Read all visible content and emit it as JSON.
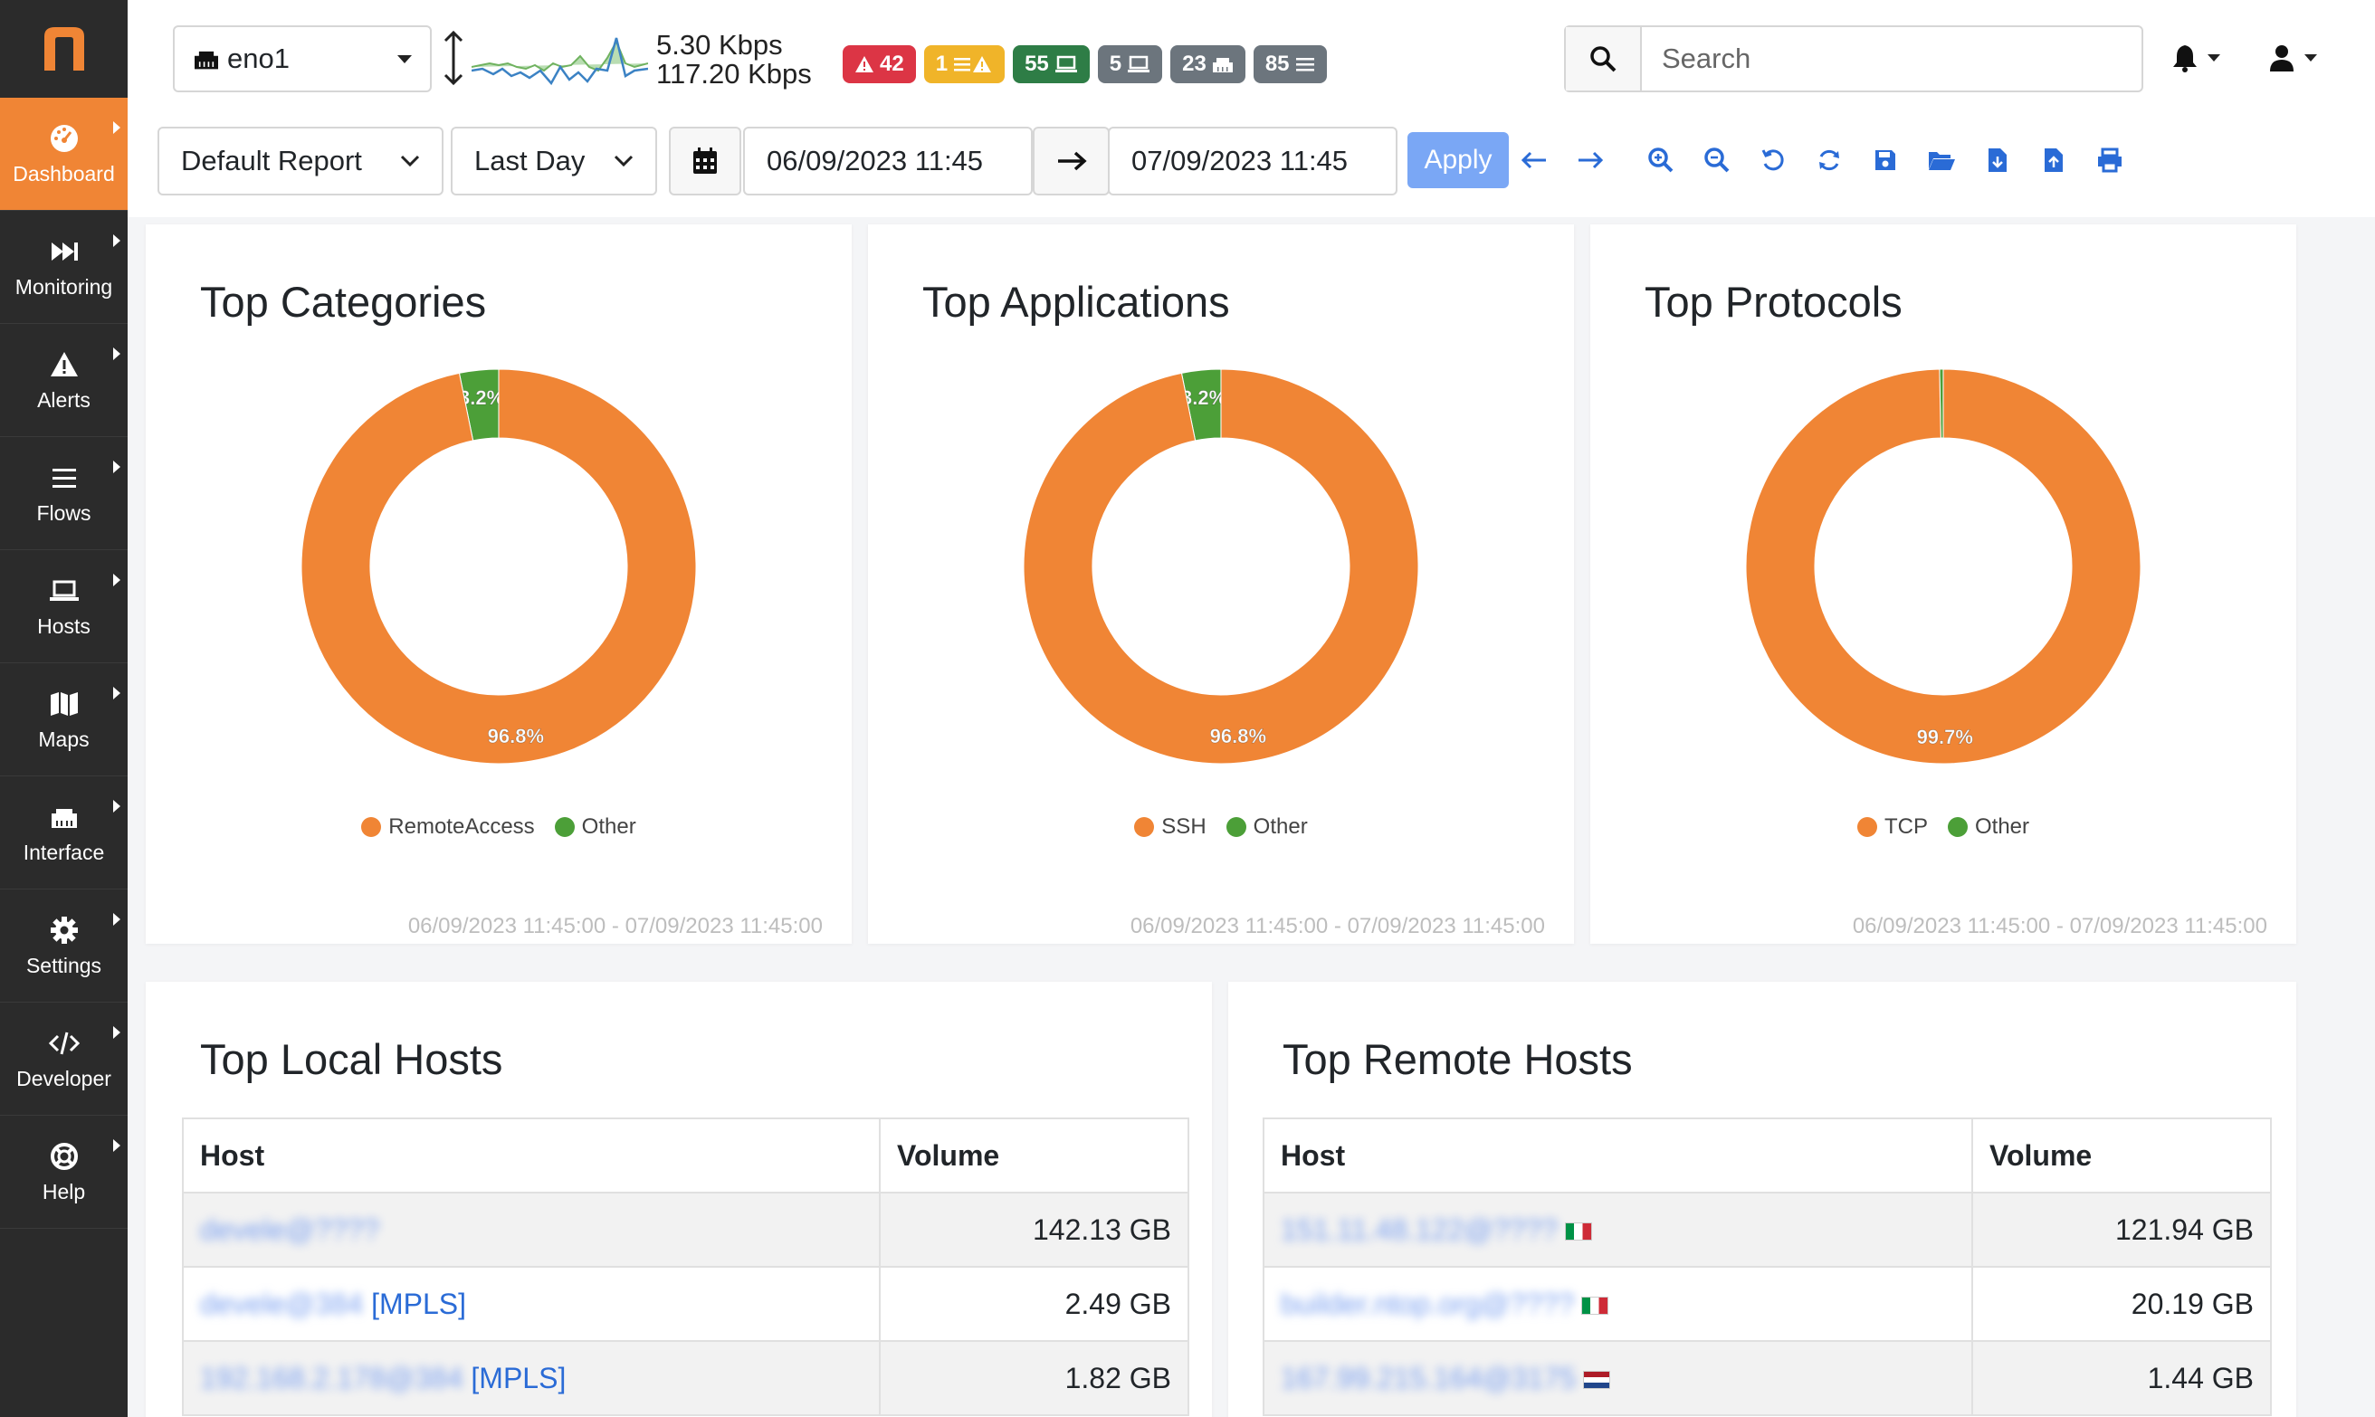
{
  "app": {
    "brand_letter": "n",
    "brand_color": "#f08535"
  },
  "sidebar": {
    "items": [
      {
        "label": "Dashboard",
        "icon": "gauge-icon",
        "active": true
      },
      {
        "label": "Monitoring",
        "icon": "fast-forward-icon"
      },
      {
        "label": "Alerts",
        "icon": "warning-icon"
      },
      {
        "label": "Flows",
        "icon": "bars-icon"
      },
      {
        "label": "Hosts",
        "icon": "laptop-icon"
      },
      {
        "label": "Maps",
        "icon": "map-icon"
      },
      {
        "label": "Interface",
        "icon": "ethernet-icon"
      },
      {
        "label": "Settings",
        "icon": "gear-icon"
      },
      {
        "label": "Developer",
        "icon": "code-icon"
      },
      {
        "label": "Help",
        "icon": "life-ring-icon"
      }
    ]
  },
  "header": {
    "interface": "eno1",
    "throughput_up": "5.30 Kbps",
    "throughput_down": "117.20 Kbps",
    "badges": [
      {
        "value": "42",
        "icon": "warning-icon",
        "color": "#dc3545"
      },
      {
        "value": "1",
        "icon": "flows-warning-icon",
        "color": "#f0b429"
      },
      {
        "value": "55",
        "icon": "laptop-icon",
        "color": "#2e7d46"
      },
      {
        "value": "5",
        "icon": "laptop-icon",
        "color": "#6c757d"
      },
      {
        "value": "23",
        "icon": "ethernet-icon",
        "color": "#6c757d"
      },
      {
        "value": "85",
        "icon": "bars-icon",
        "color": "#6c757d"
      }
    ],
    "search_placeholder": "Search"
  },
  "toolbar": {
    "report": "Default Report",
    "range": "Last Day",
    "date_from": "06/09/2023 11:45",
    "date_to": "07/09/2023 11:45",
    "apply_label": "Apply"
  },
  "charts": {
    "categories": {
      "title": "Top Categories",
      "timestamp": "06/09/2023 11:45:00 - 07/09/2023 11:45:00"
    },
    "applications": {
      "title": "Top Applications",
      "timestamp": "06/09/2023 11:45:00 - 07/09/2023 11:45:00"
    },
    "protocols": {
      "title": "Top Protocols",
      "timestamp": "06/09/2023 11:45:00 - 07/09/2023 11:45:00"
    }
  },
  "chart_data": [
    {
      "type": "pie",
      "title": "Top Categories",
      "labels": [
        "RemoteAccess",
        "Other"
      ],
      "values": [
        96.8,
        3.2
      ],
      "colors": [
        "#f08535",
        "#4c9f38"
      ],
      "legend": "bottom"
    },
    {
      "type": "pie",
      "title": "Top Applications",
      "labels": [
        "SSH",
        "Other"
      ],
      "values": [
        96.8,
        3.2
      ],
      "colors": [
        "#f08535",
        "#4c9f38"
      ],
      "legend": "bottom"
    },
    {
      "type": "pie",
      "title": "Top Protocols",
      "labels": [
        "TCP",
        "Other"
      ],
      "values": [
        99.7,
        0.3
      ],
      "colors": [
        "#f08535",
        "#4c9f38"
      ],
      "legend": "bottom"
    }
  ],
  "local_hosts": {
    "title": "Top Local Hosts",
    "col_host": "Host",
    "col_volume": "Volume",
    "rows": [
      {
        "host": "devele@????",
        "tag": "",
        "volume": "142.13 GB"
      },
      {
        "host": "devele@384",
        "tag": "[MPLS]",
        "volume": "2.49 GB"
      },
      {
        "host": "192.168.2.178@384",
        "tag": "[MPLS]",
        "volume": "1.82 GB"
      }
    ]
  },
  "remote_hosts": {
    "title": "Top Remote Hosts",
    "col_host": "Host",
    "col_volume": "Volume",
    "rows": [
      {
        "host": "151.11.48.122@????",
        "flag": "it",
        "volume": "121.94 GB"
      },
      {
        "host": "builder.ntop.org@????",
        "flag": "it",
        "volume": "20.19 GB"
      },
      {
        "host": "167.99.215.164@3175",
        "flag": "nl",
        "volume": "1.44 GB"
      }
    ]
  }
}
